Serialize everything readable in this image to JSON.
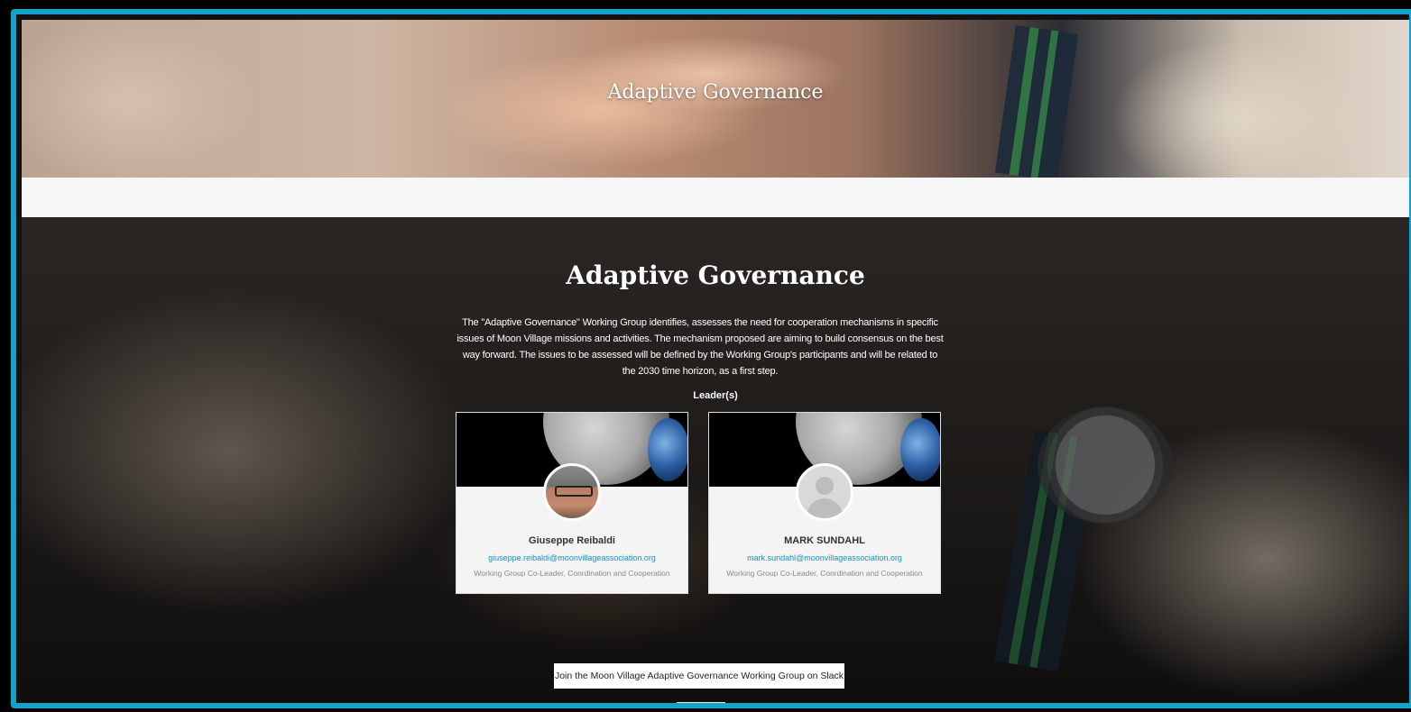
{
  "hero": {
    "title": "Adaptive Governance"
  },
  "section": {
    "title": "Adaptive Governance",
    "description": "The \"Adaptive Governance\" Working Group identifies, assesses the need for cooperation mechanisms in specific issues of Moon Village missions and activities. The mechanism proposed are aiming to build consensus on the best way forward. The issues to be assessed will be defined by the Working Group's participants and will be related to the 2030 time horizon, as a first step.",
    "leaders_label": "Leader(s)"
  },
  "leaders": [
    {
      "name": "Giuseppe Reibaldi",
      "email": "giuseppe.reibaldi@moonvillageassociation.org",
      "role": "Working Group Co-Leader, Coordination and Cooperation",
      "avatar_icon": "person-photo"
    },
    {
      "name": "MARK SUNDAHL",
      "email": "mark.sundahl@moonvillageassociation.org",
      "role": "Working Group Co-Leader, Coordination and Cooperation",
      "avatar_icon": "default-user-icon"
    }
  ],
  "slack_button": {
    "label": "Join the Moon Village Adaptive Governance Working Group on Slack"
  },
  "colors": {
    "frame_border": "#16a2c8",
    "email_link": "#1a8fc0"
  }
}
